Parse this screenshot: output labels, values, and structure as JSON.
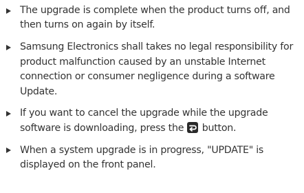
{
  "notes": [
    "The upgrade is complete when the product turns off, and then turns on again by itself.",
    "Samsung Electronics shall takes no legal responsibility for product malfunction caused by an unstable Internet connection or consumer negligence during a software Update.",
    {
      "before": "If you want to cancel the upgrade while the upgrade software is downloading, press the",
      "icon": "return-button-icon",
      "after": " button."
    },
    "When a system upgrade is in progress, \"UPDATE\" is displayed on the front panel."
  ]
}
